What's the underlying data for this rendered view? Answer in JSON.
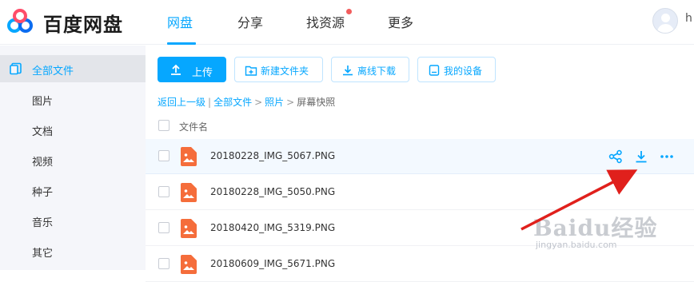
{
  "app": {
    "brand": "百度网盘",
    "accent": "#06a7ff"
  },
  "nav": {
    "items": [
      "网盘",
      "分享",
      "找资源",
      "更多"
    ],
    "active_index": 0,
    "notification_dot_on": "找资源",
    "user_initial": "h"
  },
  "sidebar": {
    "items": [
      {
        "label": "全部文件",
        "icon": "folder-icon",
        "active": true
      },
      {
        "label": "图片",
        "active": false
      },
      {
        "label": "文档",
        "active": false
      },
      {
        "label": "视频",
        "active": false
      },
      {
        "label": "种子",
        "active": false
      },
      {
        "label": "音乐",
        "active": false
      },
      {
        "label": "其它",
        "active": false
      }
    ]
  },
  "toolbar": {
    "upload": "上传",
    "new_folder": "新建文件夹",
    "offline_download": "离线下载",
    "my_devices": "我的设备"
  },
  "breadcrumb": {
    "back": "返回上一级",
    "separator_bar": "|",
    "path": [
      "全部文件",
      "照片"
    ],
    "current": "屏幕快照",
    "arrow": ">"
  },
  "file_list": {
    "header": "文件名",
    "files": [
      {
        "name": "20180228_IMG_5067.PNG",
        "hover": true
      },
      {
        "name": "20180228_IMG_5050.PNG",
        "hover": false
      },
      {
        "name": "20180420_IMG_5319.PNG",
        "hover": false
      },
      {
        "name": "20180609_IMG_5671.PNG",
        "hover": false
      }
    ],
    "row_actions": [
      "share-icon",
      "download-icon",
      "more-icon"
    ]
  },
  "watermark": {
    "text": "Baidu经验",
    "url": "jingyan.baidu.com"
  }
}
